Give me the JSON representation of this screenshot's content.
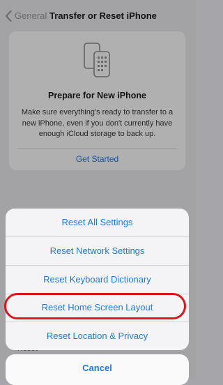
{
  "navbar": {
    "back_label": "General",
    "title": "Transfer or Reset iPhone"
  },
  "card": {
    "icon": "phones-icon",
    "title": "Prepare for New iPhone",
    "text": "Make sure everything's ready to transfer to a new iPhone, even if you don't currently have enough iCloud storage to back up.",
    "action": "Get Started"
  },
  "background": {
    "reset_label": "Reset"
  },
  "action_sheet": {
    "items": [
      {
        "label": "Reset All Settings"
      },
      {
        "label": "Reset Network Settings"
      },
      {
        "label": "Reset Keyboard Dictionary"
      },
      {
        "label": "Reset Home Screen Layout",
        "highlighted": true
      },
      {
        "label": "Reset Location & Privacy"
      }
    ],
    "cancel_label": "Cancel"
  },
  "colors": {
    "accent": "#1f7ae0",
    "highlight": "#e0141c"
  }
}
